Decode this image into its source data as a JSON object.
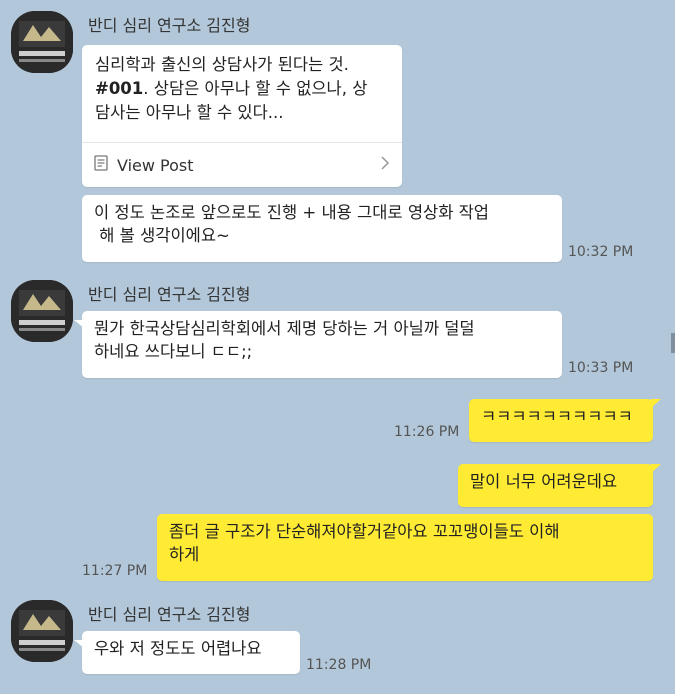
{
  "messages": {
    "group1": {
      "sender": "반디 심리 연구소 김진형",
      "card": {
        "line1": "심리학과 출신의 상담사가 된다는 것.",
        "line2_bold": "#001",
        "line2_rest": ". 상담은 아무나 할 수 없으나, 상",
        "line3": "담사는 아무나 할 수 있다...",
        "link_label": "View Post"
      },
      "bubble2": "이 정도 논조로 앞으로도 진행 + 내용 그대로 영상화 작업\n 해 볼 생각이에요~",
      "time": "10:32 PM"
    },
    "group2": {
      "sender": "반디 심리 연구소 김진형",
      "bubble": "뭔가 한국상담심리학회에서 제명 당하는 거 아닐까 덜덜\n하네요 쓰다보니 ㄷㄷ;;",
      "time": "10:33 PM"
    },
    "mine": {
      "bubble1": "ㅋㅋㅋㅋㅋㅋㅋㅋㅋㅋ",
      "time1": "11:26 PM",
      "bubble2": "말이 너무 어려운데요",
      "bubble3": "좀더 글 구조가 단순해져야할거같아요 꼬꼬맹이들도 이해\n하게",
      "time3": "11:27 PM"
    },
    "group3": {
      "sender": "반디 심리 연구소 김진형",
      "bubble": "우와 저 정도도 어렵나요",
      "time": "11:28 PM"
    }
  },
  "colors": {
    "background": "#b2c7d9",
    "my_bubble": "#ffeb33",
    "their_bubble": "#ffffff"
  },
  "icons": {
    "card_doc": "document-icon",
    "card_chevron": "chevron-right-icon"
  }
}
